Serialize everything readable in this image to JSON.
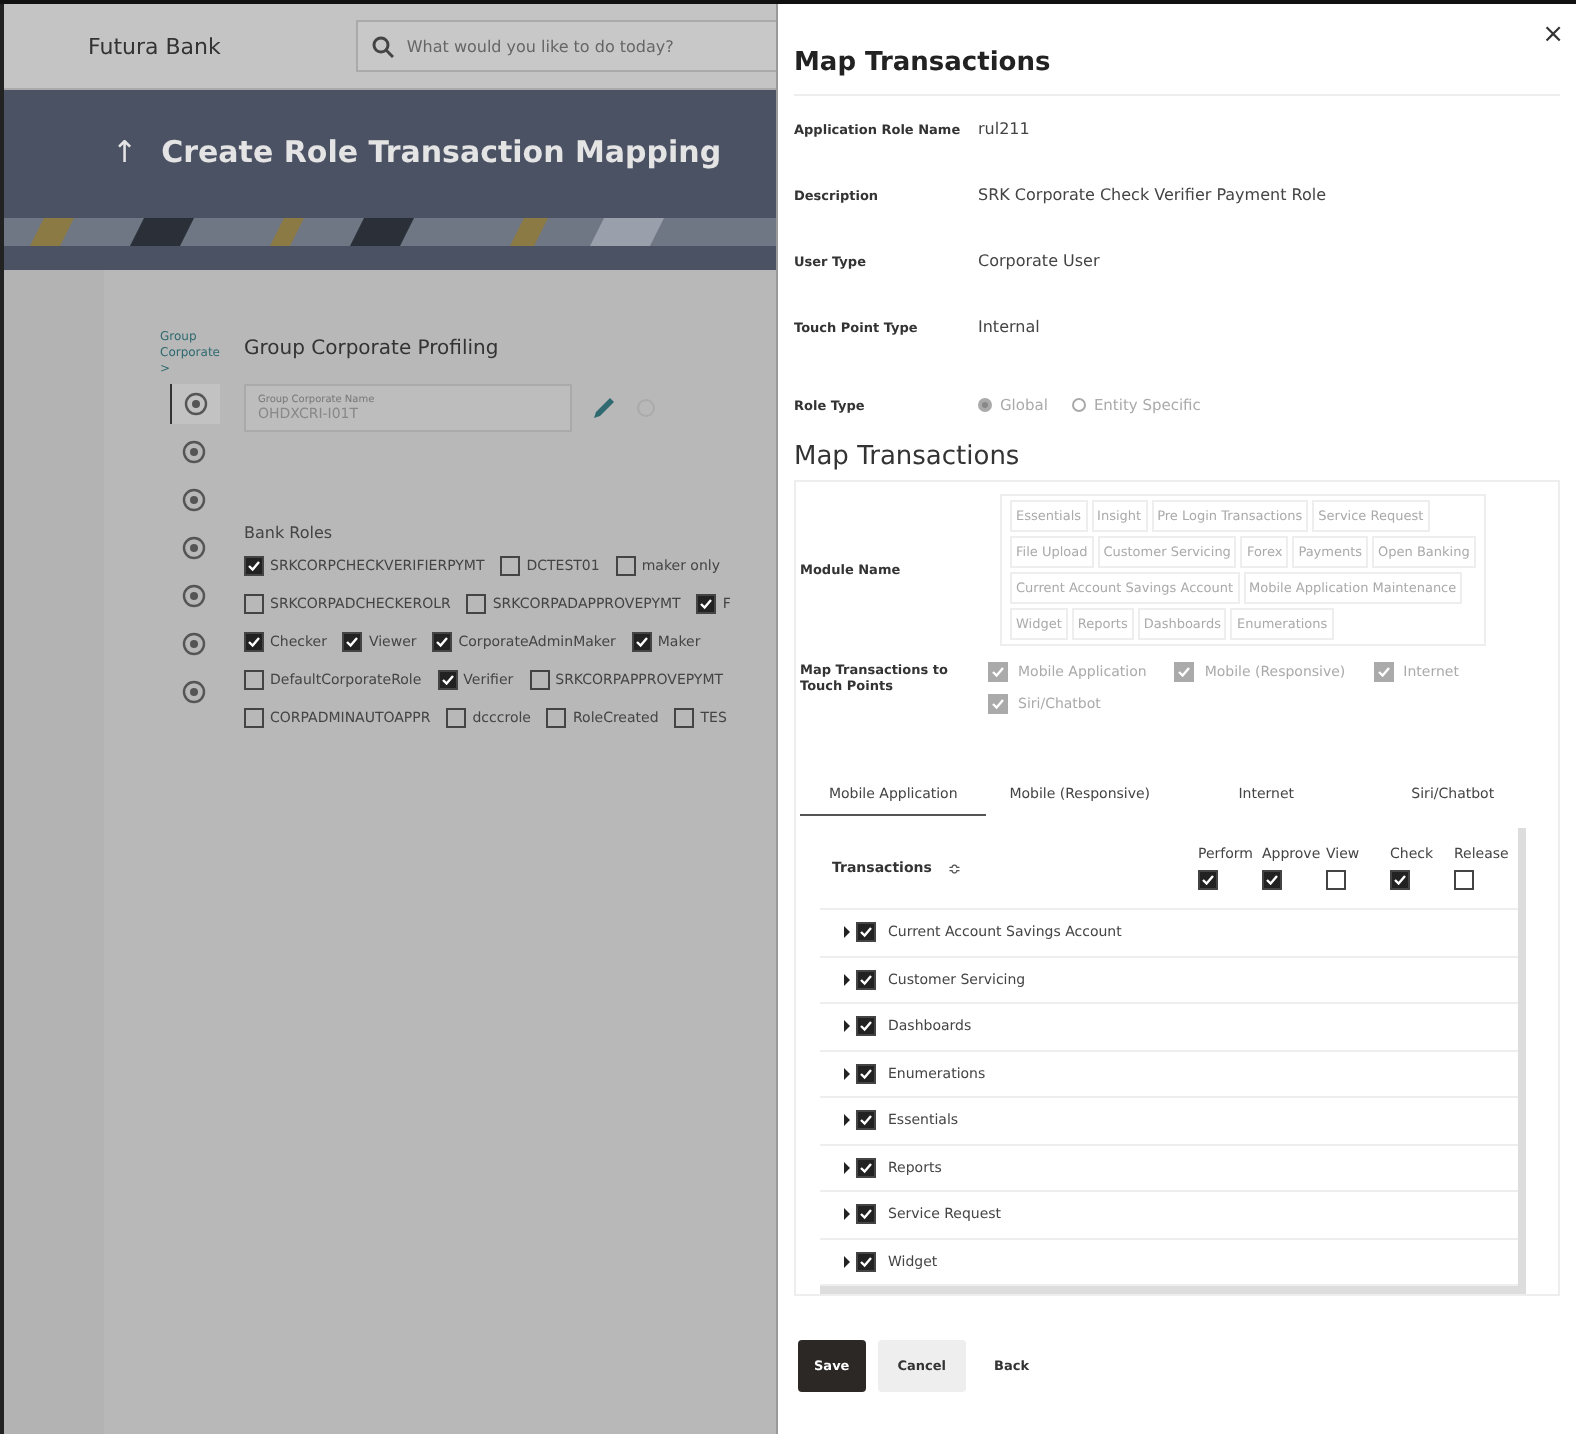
{
  "app": {
    "brand": "Futura Bank",
    "search_placeholder": "What would you like to do today?"
  },
  "page": {
    "back": "↑",
    "title": "Create Role Transaction Mapping"
  },
  "breadcrumb": "Group Corporate >",
  "sidebar": {
    "items": [
      {
        "selected": true
      },
      {
        "selected": false
      },
      {
        "selected": false
      },
      {
        "selected": false
      },
      {
        "selected": false
      },
      {
        "selected": false
      },
      {
        "selected": false
      }
    ]
  },
  "profile": {
    "title": "Group Corporate Profiling",
    "field_label": "Group Corporate Name",
    "field_value": "OHDXCRI-I01T"
  },
  "bank_roles": {
    "title": "Bank Roles",
    "roles": [
      {
        "label": "SRKCORPCHECKVERIFIERPYMT",
        "checked": true
      },
      {
        "label": "DCTEST01",
        "checked": false
      },
      {
        "label": "maker only",
        "checked": false
      },
      {
        "label": "SRKCORPADCHECKEROLR",
        "checked": false
      },
      {
        "label": "SRKCORPADAPPROVEPYMT",
        "checked": false
      },
      {
        "label": "F",
        "checked": true
      },
      {
        "label": "Checker",
        "checked": true
      },
      {
        "label": "Viewer",
        "checked": true
      },
      {
        "label": "CorporateAdminMaker",
        "checked": true
      },
      {
        "label": "Maker",
        "checked": true
      },
      {
        "label": "DefaultCorporateRole",
        "checked": false
      },
      {
        "label": "Verifier",
        "checked": true
      },
      {
        "label": "SRKCORPAPPROVEPYMT",
        "checked": false
      },
      {
        "label": "CORPADMINAUTOAPPR",
        "checked": false
      },
      {
        "label": "dcccrole",
        "checked": false
      },
      {
        "label": "RoleCreated",
        "checked": false
      },
      {
        "label": "TES",
        "checked": false
      }
    ]
  },
  "drawer": {
    "title": "Map Transactions",
    "close": "×",
    "details": [
      {
        "label": "Application Role Name",
        "value": "rul211"
      },
      {
        "label": "Description",
        "value": "SRK Corporate Check Verifier Payment Role"
      },
      {
        "label": "User Type",
        "value": "Corporate User"
      },
      {
        "label": "Touch Point Type",
        "value": "Internal"
      }
    ],
    "role_type": {
      "label": "Role Type",
      "options": [
        {
          "label": "Global",
          "selected": true
        },
        {
          "label": "Entity Specific",
          "selected": false
        }
      ]
    },
    "section_title": "Map Transactions",
    "module_label": "Module Name",
    "modules": [
      [
        "Essentials",
        "Insight",
        "Pre Login Transactions",
        "Service Request"
      ],
      [
        "File Upload",
        "Customer Servicing",
        "Forex",
        "Payments",
        "Open Banking"
      ],
      [
        "Current Account Savings Account",
        "Mobile Application Maintenance"
      ],
      [
        "Widget",
        "Reports",
        "Dashboards",
        "Enumerations"
      ]
    ],
    "touch_label": "Map Transactions to Touch Points",
    "touch_points": [
      {
        "label": "Mobile Application",
        "checked": true
      },
      {
        "label": "Mobile (Responsive)",
        "checked": true
      },
      {
        "label": "Internet",
        "checked": true
      },
      {
        "label": "Siri/Chatbot",
        "checked": true
      }
    ],
    "tabs": [
      {
        "label": "Mobile Application",
        "selected": true
      },
      {
        "label": "Mobile (Responsive)",
        "selected": false
      },
      {
        "label": "Internet",
        "selected": false
      },
      {
        "label": "Siri/Chatbot",
        "selected": false
      }
    ],
    "table": {
      "title": "Transactions",
      "sort": "≎",
      "columns": [
        {
          "label": "Perform",
          "checked": true
        },
        {
          "label": "Approve",
          "checked": true
        },
        {
          "label": "View",
          "checked": false
        },
        {
          "label": "Check",
          "checked": true
        },
        {
          "label": "Release",
          "checked": false
        }
      ],
      "rows": [
        {
          "label": "Current Account Savings Account",
          "checked": true,
          "expanded": false
        },
        {
          "label": "Customer Servicing",
          "checked": true,
          "expanded": false
        },
        {
          "label": "Dashboards",
          "checked": true,
          "expanded": false
        },
        {
          "label": "Enumerations",
          "checked": true,
          "expanded": false
        },
        {
          "label": "Essentials",
          "checked": true,
          "expanded": false
        },
        {
          "label": "Reports",
          "checked": true,
          "expanded": false
        },
        {
          "label": "Service Request",
          "checked": true,
          "expanded": false
        },
        {
          "label": "Widget",
          "checked": true,
          "expanded": false
        }
      ]
    },
    "buttons": [
      {
        "label": "Save",
        "kind": "primary"
      },
      {
        "label": "Cancel",
        "kind": "secondary"
      },
      {
        "label": "Back",
        "kind": "link"
      }
    ]
  }
}
